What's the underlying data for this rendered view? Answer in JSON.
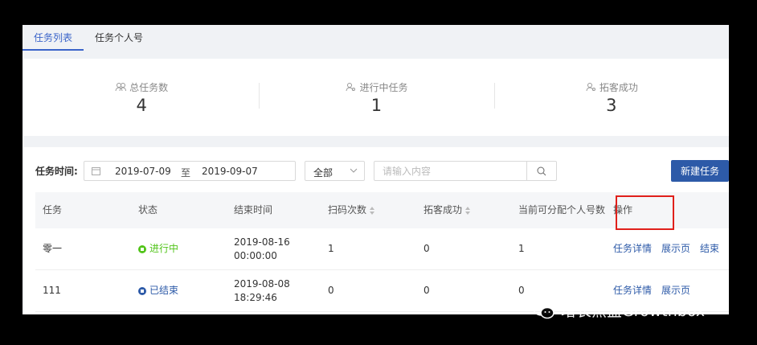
{
  "tabs": [
    {
      "label": "任务列表",
      "active": true
    },
    {
      "label": "任务个人号",
      "active": false
    }
  ],
  "stats": [
    {
      "label": "总任务数",
      "value": "4",
      "icon": "group-icon"
    },
    {
      "label": "进行中任务",
      "value": "1",
      "icon": "user-icon"
    },
    {
      "label": "拓客成功",
      "value": "3",
      "icon": "user-icon"
    }
  ],
  "filters": {
    "label": "任务时间:",
    "start_date": "2019-07-09",
    "range_sep": "至",
    "end_date": "2019-09-07",
    "status_selected": "全部",
    "search_placeholder": "请输入内容",
    "new_button": "新建任务"
  },
  "table": {
    "headers": [
      "任务",
      "状态",
      "结束时间",
      "扫码次数",
      "拓客成功",
      "当前可分配个人号数",
      "操作"
    ],
    "rows": [
      {
        "task": "零一",
        "status": "进行中",
        "end_time": "2019-08-16 00:00:00",
        "scans": "1",
        "success": "0",
        "assignable": "1",
        "actions": [
          "任务详情",
          "展示页",
          "结束"
        ]
      },
      {
        "task": "111",
        "status": "已结束",
        "end_time": "2019-08-08 18:29:46",
        "scans": "0",
        "success": "0",
        "assignable": "0",
        "actions": [
          "任务详情",
          "展示页"
        ]
      }
    ]
  },
  "colors": {
    "accent": "#2d5aa8",
    "active_status": "#52c41a",
    "highlight": "#e0201b"
  },
  "watermark": "增长黑盒Growthbox"
}
